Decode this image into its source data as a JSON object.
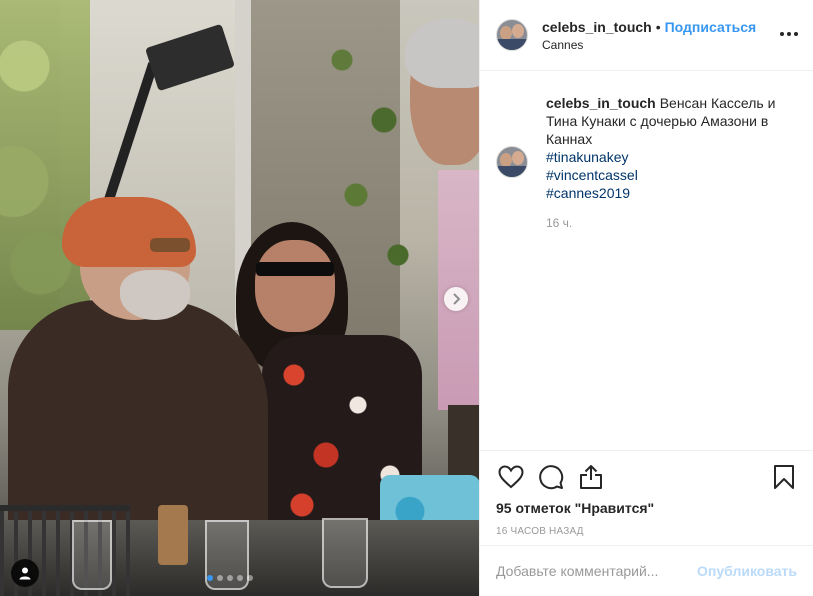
{
  "post": {
    "username": "celebs_in_touch",
    "separator": "•",
    "follow_label": "Подписаться",
    "location": "Cannes"
  },
  "caption": {
    "username": "celebs_in_touch",
    "text": "Венсан Кассель и Тина Кунаки с дочерью Амазони в Каннах",
    "hashtags": [
      "#tinakunakey",
      "#vincentcassel",
      "#cannes2019"
    ],
    "time": "16 ч."
  },
  "engagement": {
    "likes": "95 отметок \"Нравится\"",
    "timeago": "16 часов назад"
  },
  "comment_box": {
    "placeholder": "Добавьте комментарий...",
    "publish_label": "Опубликовать"
  },
  "carousel": {
    "slides": 5,
    "active_index": 0
  },
  "colors": {
    "accent": "#3897f0",
    "hashtag": "#003569",
    "muted": "#999999",
    "border": "#efefef"
  },
  "icons": {
    "like": "heart-icon",
    "comment": "comment-icon",
    "share": "share-icon",
    "save": "bookmark-icon",
    "more": "more-options-icon",
    "next": "chevron-right-icon",
    "tag": "user-tag-icon"
  }
}
